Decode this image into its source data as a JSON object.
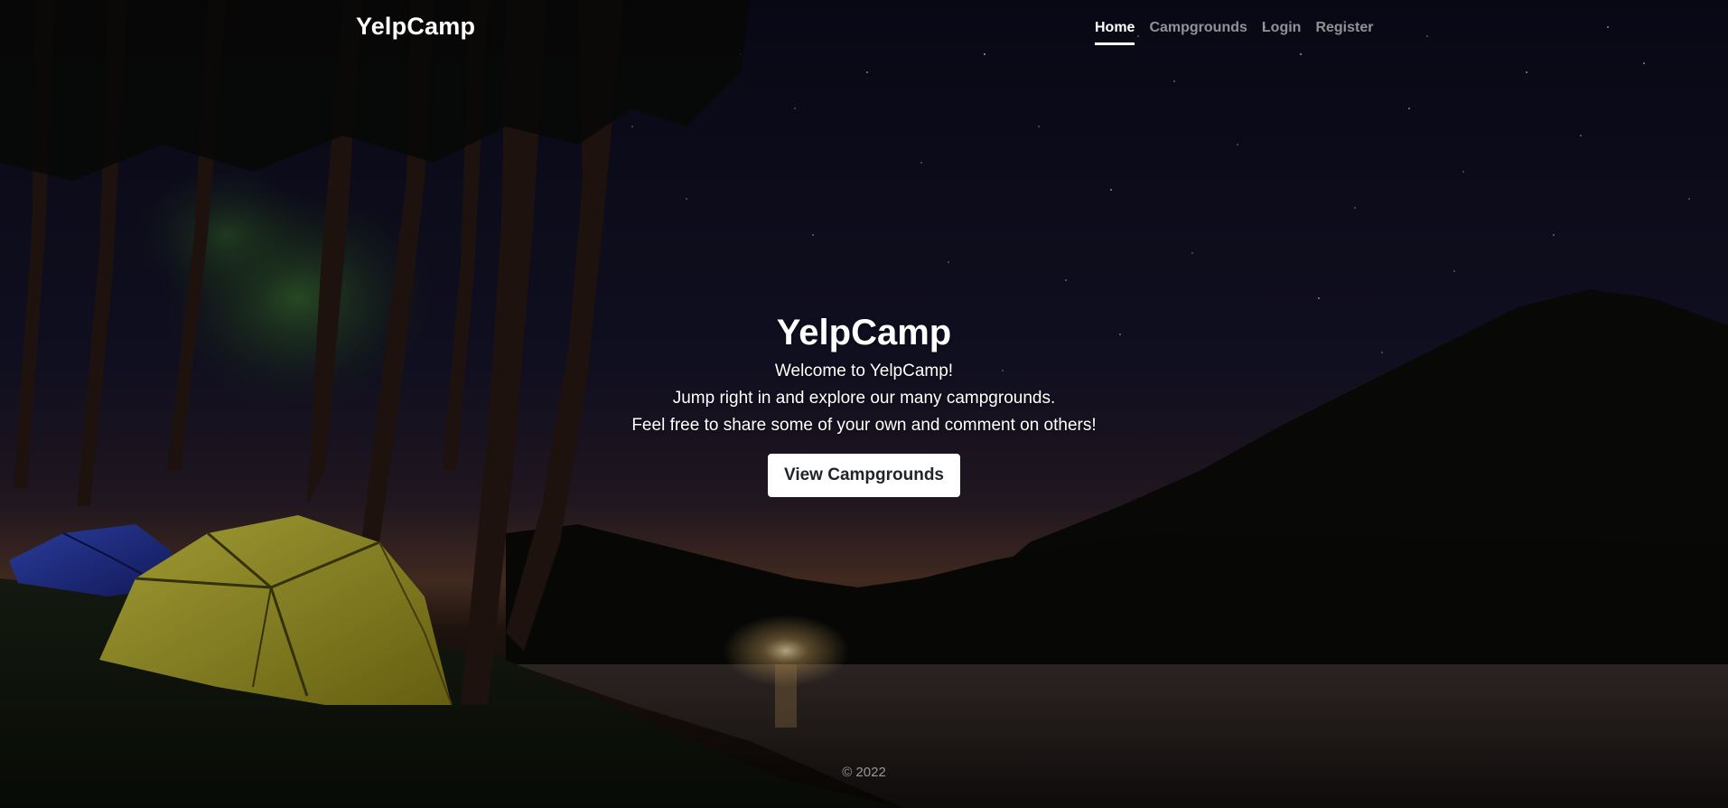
{
  "header": {
    "brand": "YelpCamp",
    "nav": [
      {
        "label": "Home",
        "active": true
      },
      {
        "label": "Campgrounds",
        "active": false
      },
      {
        "label": "Login",
        "active": false
      },
      {
        "label": "Register",
        "active": false
      }
    ]
  },
  "hero": {
    "title": "YelpCamp",
    "lines": [
      "Welcome to YelpCamp!",
      "Jump right in and explore our many campgrounds.",
      "Feel free to share some of your own and comment on others!"
    ],
    "button_label": "View Campgrounds"
  },
  "footer": {
    "copyright": "© 2022"
  },
  "colors": {
    "sky_top": "#0d0d22",
    "sky_horizon": "#5a3a2c",
    "button_bg": "#ffffff",
    "button_text": "#212529",
    "nav_inactive": "#8c8c8c",
    "tent_yellow": "#c9c22a",
    "tent_blue": "#2a3fb0"
  }
}
